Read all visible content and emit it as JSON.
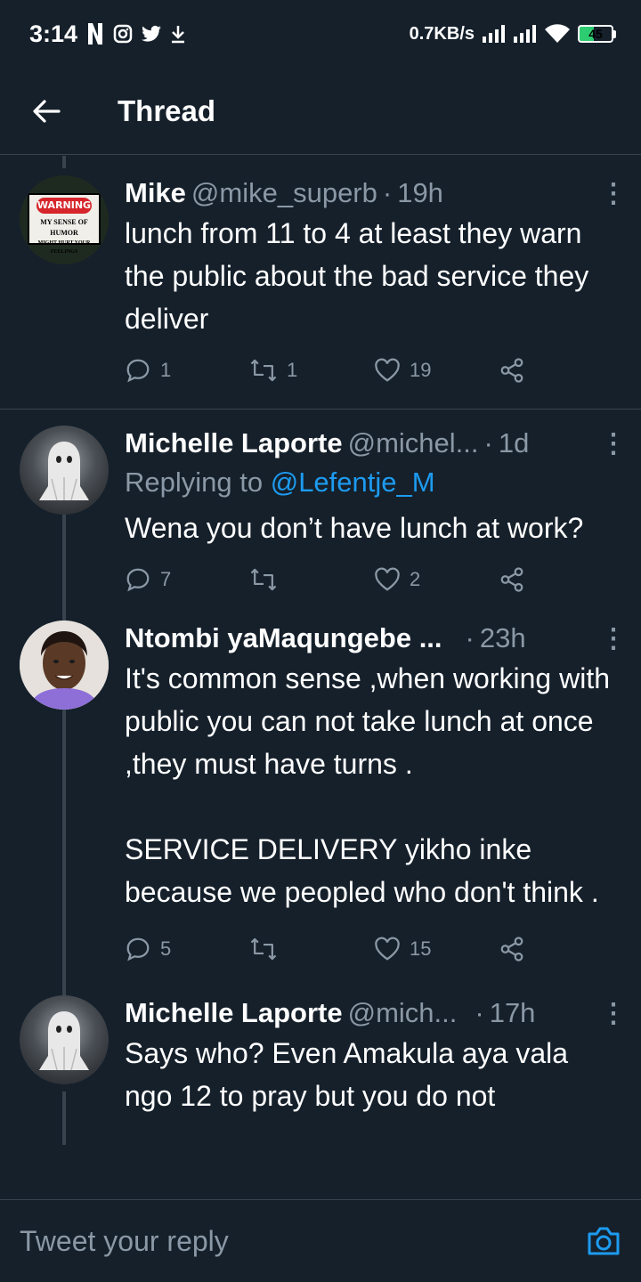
{
  "status_bar": {
    "time": "3:14",
    "net_speed": "0.7KB/s",
    "battery": "45",
    "icons": [
      "netflix-icon",
      "instagram-icon",
      "twitter-icon",
      "download-icon",
      "signal-icon",
      "wifi-icon",
      "battery-icon"
    ]
  },
  "header": {
    "title": "Thread"
  },
  "tweets": [
    {
      "name": "Mike",
      "handle": "@mike_superb",
      "dot": "·",
      "time": "19h",
      "avatar": {
        "top": "WARNING",
        "line1": "MY SENSE OF HUMOR",
        "line2": "MIGHT HURT YOUR FEELINGS"
      },
      "text": "lunch from 11 to 4 at least they warn the public about the bad service they deliver",
      "replies": "1",
      "retweets": "1",
      "likes": "19"
    },
    {
      "name": "Michelle Laporte",
      "handle": "@michel...",
      "dot": "·",
      "time": "1d",
      "replying_prefix": "Replying to",
      "replying_to": "@Lefentje_M",
      "text": "Wena you don’t have lunch at work?",
      "replies": "7",
      "retweets": "",
      "likes": "2"
    },
    {
      "name": "Ntombi yaMaqungebe ...",
      "handle": "",
      "dot": "·",
      "time": "23h",
      "text": "It's common sense ,when working with public you can not take lunch at once ,they must have turns .\n\nSERVICE DELIVERY yikho inke because we peopled who don't think .",
      "replies": "5",
      "retweets": "",
      "likes": "15"
    },
    {
      "name": "Michelle Laporte",
      "handle": "@mich...",
      "dot": "·",
      "time": "17h",
      "text": "Says who? Even Amakula aya vala ngo 12 to pray but you do not"
    }
  ],
  "reply_bar": {
    "placeholder": "Tweet your reply"
  },
  "colors": {
    "background": "#15202b",
    "secondary_text": "#8b98a5",
    "accent": "#1d9bf0",
    "divider": "#38444d"
  }
}
